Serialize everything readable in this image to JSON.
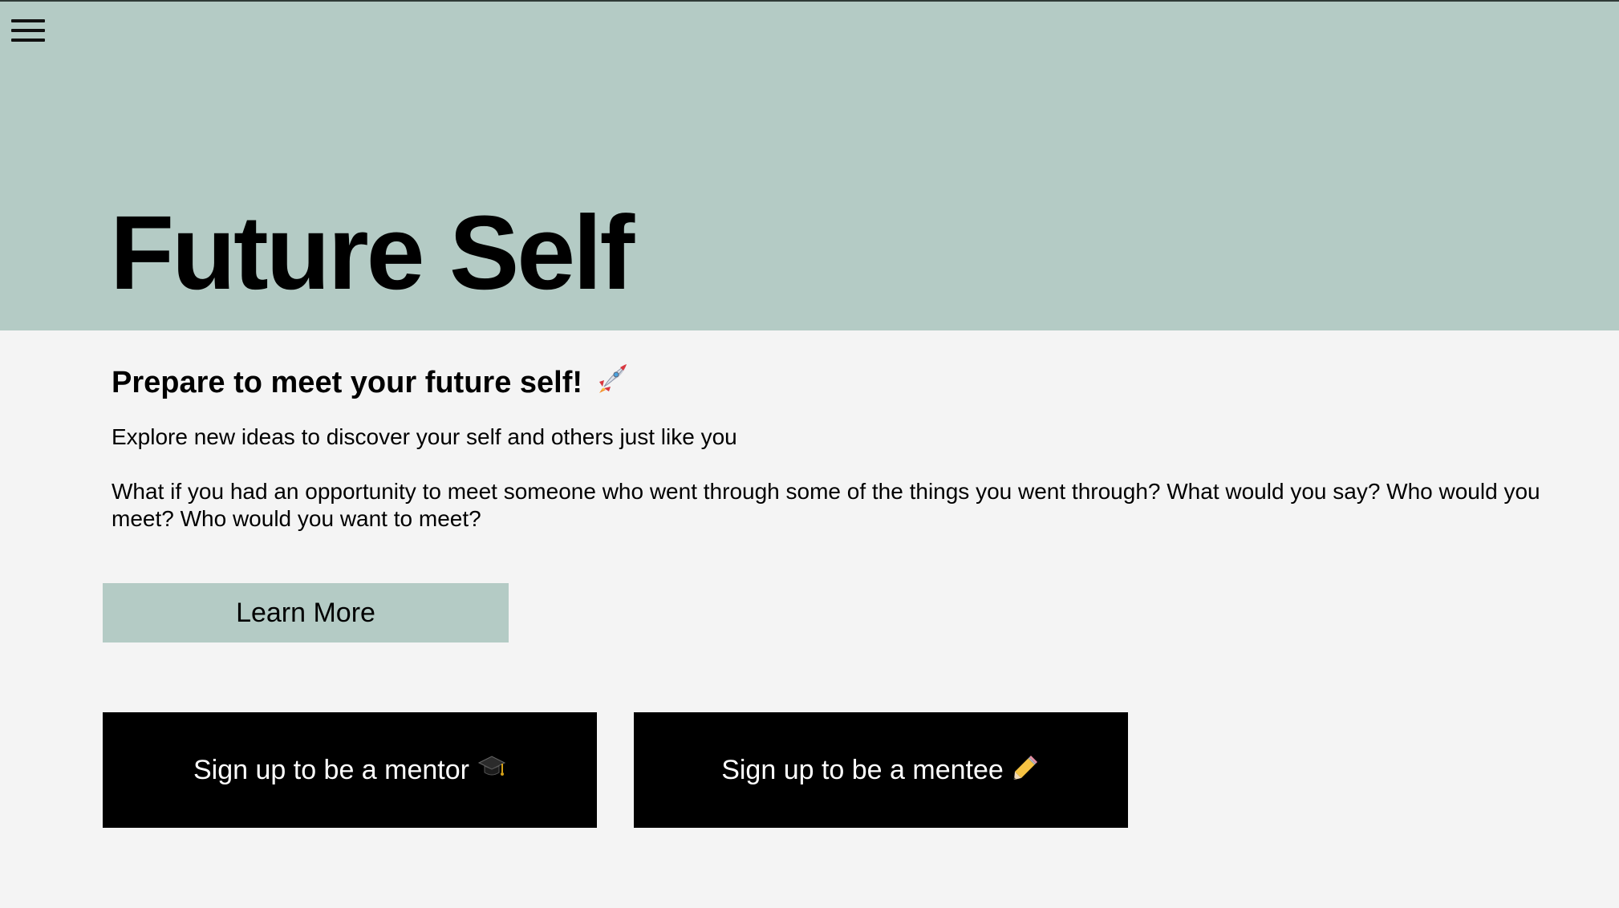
{
  "header": {
    "title": "Future Self",
    "menu_icon": "hamburger-menu-icon",
    "background": "#b4cbc5"
  },
  "main": {
    "subtitle": "Prepare to meet your future self!",
    "subtitle_icon": "rocket-icon",
    "lead": "Explore new ideas to discover your self and others just like you",
    "question": "What if you had an opportunity to meet someone who went through some of the things you went through? What would you say? Who would you meet? Who would you want to meet?",
    "learn_more_label": "Learn More"
  },
  "signup": {
    "mentor_label": "Sign up to be a mentor",
    "mentor_icon": "graduation-cap-icon",
    "mentee_label": "Sign up to be a mentee",
    "mentee_icon": "pencil-icon"
  },
  "colors": {
    "accent": "#b4cbc5",
    "page_background": "#f4f4f4",
    "button_dark": "#000000"
  }
}
